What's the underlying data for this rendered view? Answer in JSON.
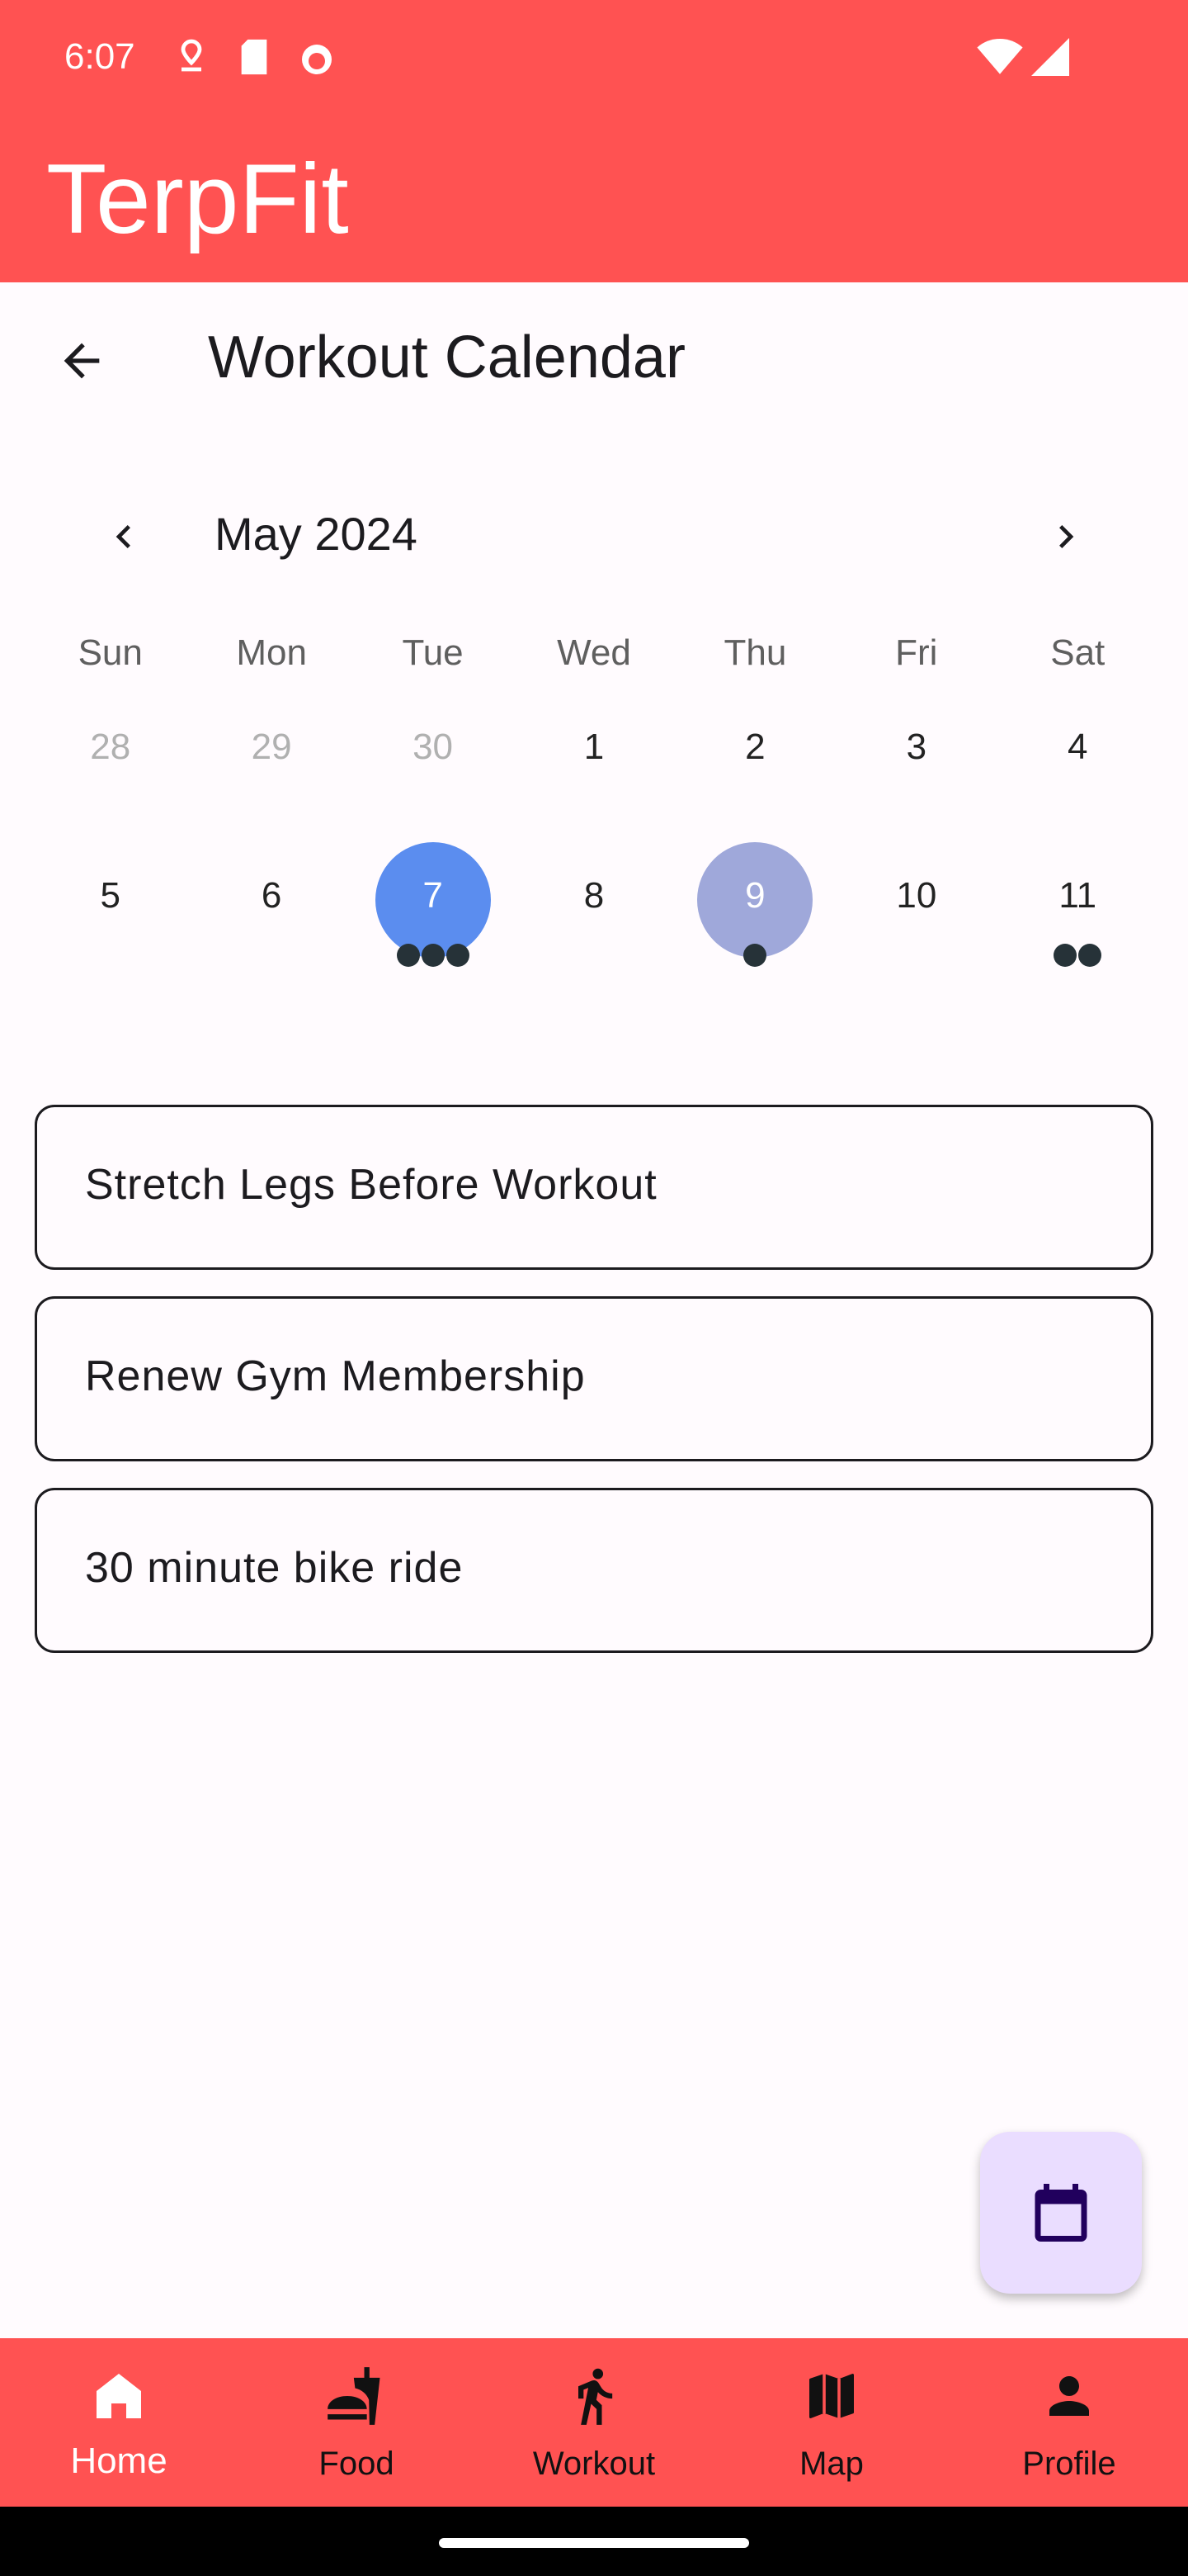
{
  "status_bar": {
    "time": "6:07",
    "icons": [
      "location-pin-icon",
      "sd-card-icon",
      "cat-face-icon",
      "wifi-icon",
      "cellular-signal-icon"
    ]
  },
  "app_bar": {
    "title": "TerpFit",
    "color": "#FF5252"
  },
  "screen": {
    "title": "Workout Calendar",
    "back_icon": "arrow-back-icon"
  },
  "calendar": {
    "month_label": "May 2024",
    "prev_icon": "chevron-left-icon",
    "next_icon": "chevron-right-icon",
    "weekdays": [
      "Sun",
      "Mon",
      "Tue",
      "Wed",
      "Thu",
      "Fri",
      "Sat"
    ],
    "weeks": [
      [
        {
          "day": "28",
          "outside": true,
          "events": 0
        },
        {
          "day": "29",
          "outside": true,
          "events": 0
        },
        {
          "day": "30",
          "outside": true,
          "events": 0
        },
        {
          "day": "1",
          "events": 0
        },
        {
          "day": "2",
          "events": 0
        },
        {
          "day": "3",
          "events": 0
        },
        {
          "day": "4",
          "events": 0
        }
      ],
      [
        {
          "day": "5",
          "events": 0
        },
        {
          "day": "6",
          "events": 0
        },
        {
          "day": "7",
          "selected": true,
          "events": 3
        },
        {
          "day": "8",
          "events": 0
        },
        {
          "day": "9",
          "today": true,
          "events": 1
        },
        {
          "day": "10",
          "events": 0
        },
        {
          "day": "11",
          "events": 2
        }
      ]
    ],
    "selected_color": "#5B8DEF",
    "today_color": "#9FA8DA"
  },
  "events": [
    {
      "label": "Stretch Legs Before Workout"
    },
    {
      "label": "Renew Gym Membership"
    },
    {
      "label": "30 minute bike ride"
    }
  ],
  "fab": {
    "icon": "calendar-icon",
    "color": "#EADDFF"
  },
  "bottom_nav": {
    "items": [
      {
        "label": "Home",
        "icon": "home-icon",
        "active": true
      },
      {
        "label": "Food",
        "icon": "fastfood-icon"
      },
      {
        "label": "Workout",
        "icon": "running-person-icon"
      },
      {
        "label": "Map",
        "icon": "map-icon"
      },
      {
        "label": "Profile",
        "icon": "person-icon"
      }
    ]
  }
}
